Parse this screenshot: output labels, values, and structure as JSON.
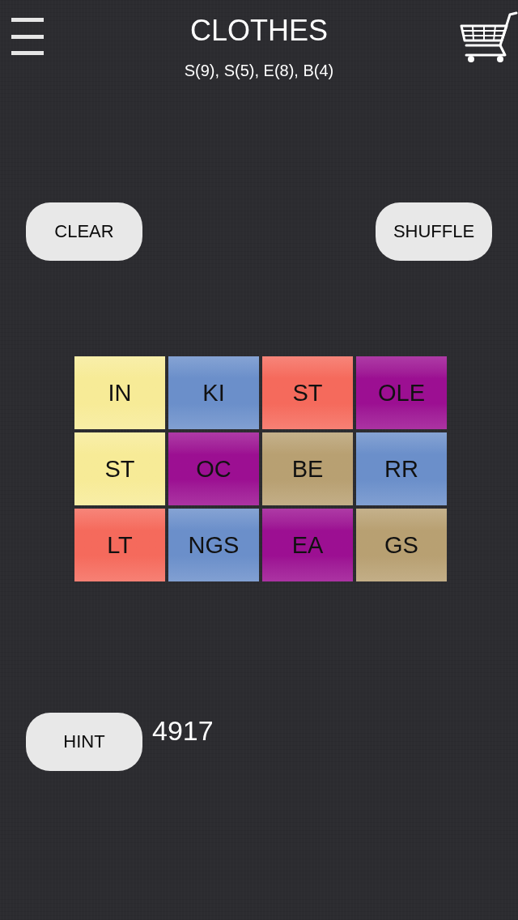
{
  "header": {
    "title": "CLOTHES",
    "subtitle": "S(9), S(5), E(8), B(4)"
  },
  "top_buttons": [
    {
      "label": "CLEAR"
    },
    {
      "label": "SHUFFLE"
    }
  ],
  "tiles": [
    {
      "label": "IN",
      "color": "#f7eb97"
    },
    {
      "label": "KI",
      "color": "#6b8fca"
    },
    {
      "label": "ST",
      "color": "#f56a5c"
    },
    {
      "label": "OLE",
      "color": "#9c0f92"
    },
    {
      "label": "ST",
      "color": "#f7eb97"
    },
    {
      "label": "OC",
      "color": "#9c0f92"
    },
    {
      "label": "BE",
      "color": "#b8a072"
    },
    {
      "label": "RR",
      "color": "#6b8fca"
    },
    {
      "label": "LT",
      "color": "#f56a5c"
    },
    {
      "label": "NGS",
      "color": "#6b8fca"
    },
    {
      "label": "EA",
      "color": "#9c0f92"
    },
    {
      "label": "GS",
      "color": "#b8a072"
    }
  ],
  "hint": {
    "label": "HINT",
    "score": "4917"
  }
}
